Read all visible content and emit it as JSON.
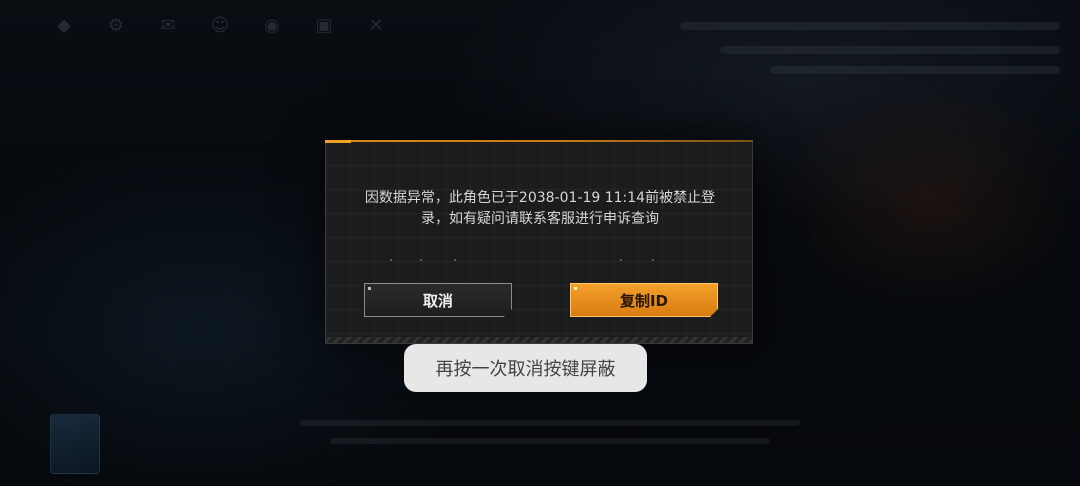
{
  "dialog": {
    "message_line1": "因数据异常，此角色已于2038-01-19 11:14前被禁止登",
    "message_line2": "录，如有疑问请联系客服进行申诉查询",
    "cancel_label": "取消",
    "copy_id_label": "复制ID"
  },
  "toast": {
    "text": "再按一次取消按键屏蔽"
  },
  "background": {
    "top_icons": [
      "home-icon",
      "settings-icon",
      "mail-icon",
      "friends-icon",
      "notice-icon",
      "gift-icon",
      "close-icon"
    ]
  },
  "colors": {
    "accent": "#f0a024",
    "dialog_bg": "#1b1c1e",
    "toast_bg": "#f0f0f0"
  }
}
